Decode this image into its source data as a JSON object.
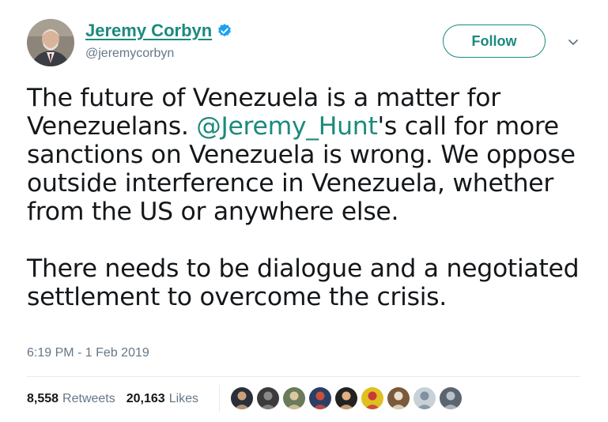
{
  "user": {
    "display_name": "Jeremy Corbyn",
    "handle": "@jeremycorbyn",
    "verified": true
  },
  "actions": {
    "follow_label": "Follow",
    "caret_icon": "chevron-down-icon"
  },
  "tweet": {
    "paragraph1_before": "The future of Venezuela is a matter for\nVenezuelans. ",
    "mention": "@Jeremy_Hunt",
    "paragraph1_after": "'s call for more\nsanctions on Venezuela is wrong. We oppose\noutside interference in Venezuela, whether\nfrom the US or anywhere else.",
    "paragraph2": "There needs to be dialogue and a negotiated\nsettlement to overcome the crisis.",
    "timestamp": "6:19 PM - 1 Feb 2019"
  },
  "stats": {
    "retweets_count": "8,558",
    "retweets_label": "Retweets",
    "likes_count": "20,163",
    "likes_label": "Likes"
  },
  "colors": {
    "accent": "#1b8a7c",
    "verified": "#1da1f2",
    "muted": "#657786",
    "text": "#14171a"
  },
  "likers": [
    {
      "color": "#2a2f3a",
      "accent": "#c9a27a"
    },
    {
      "color": "#3b3b3b",
      "accent": "#8a8a8a"
    },
    {
      "color": "#6b7a5a",
      "accent": "#d8c9a0"
    },
    {
      "color": "#2b3f66",
      "accent": "#c8503c"
    },
    {
      "color": "#222222",
      "accent": "#e0b080"
    },
    {
      "color": "#e0c020",
      "accent": "#c83a3a"
    },
    {
      "color": "#7a5a3a",
      "accent": "#e8e0d0"
    },
    {
      "color": "#c8d0d8",
      "accent": "#8090a0"
    },
    {
      "color": "#5a6570",
      "accent": "#b8c0c8"
    }
  ]
}
